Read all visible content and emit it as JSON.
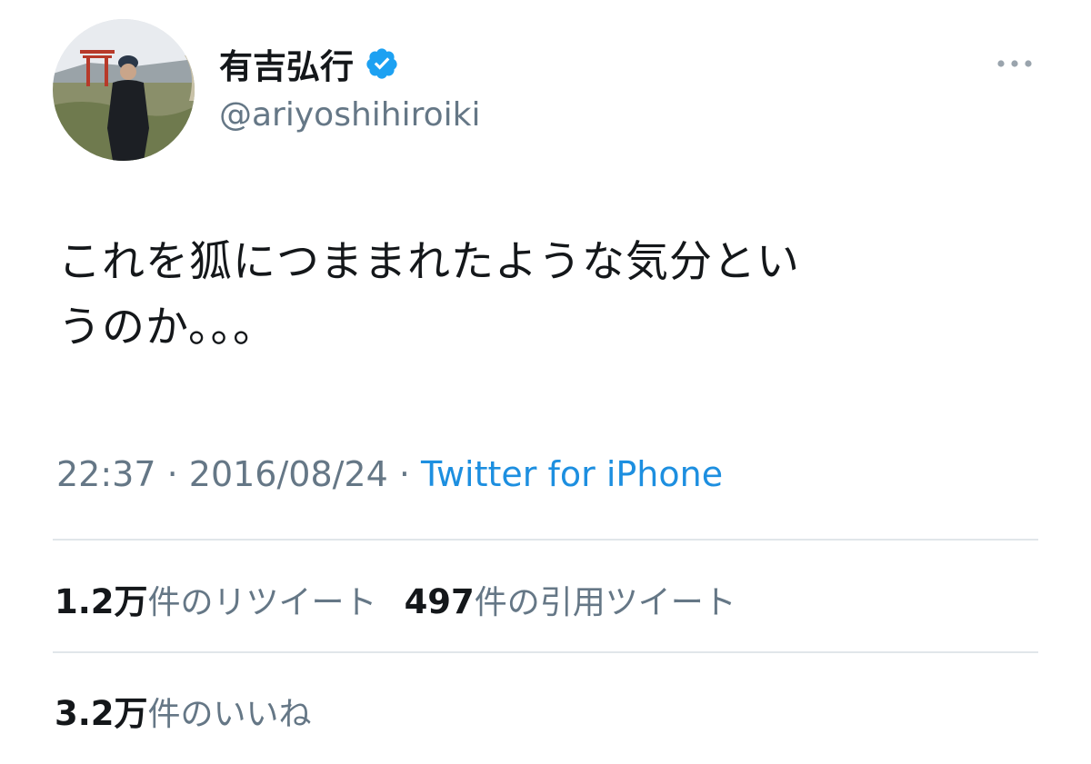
{
  "user": {
    "display_name": "有吉弘行",
    "handle": "@ariyoshihiroiki",
    "verified_color": "#1da1f2"
  },
  "tweet": {
    "text_line1": "これを狐につままれたような気分とい",
    "text_line2": "うのか。。。"
  },
  "meta": {
    "time": "22:37",
    "separator": " · ",
    "date": "2016/08/24",
    "source": "Twitter for iPhone",
    "source_color": "#1d8fe0"
  },
  "stats": {
    "retweets_count": "1.2万",
    "retweets_label": "件のリツイート",
    "quotes_count": "497",
    "quotes_label": "件の引用ツイート",
    "likes_count": "3.2万",
    "likes_label": "件のいいね"
  },
  "icons": {
    "more": "more-dots-icon",
    "verified": "verified-badge-icon"
  }
}
